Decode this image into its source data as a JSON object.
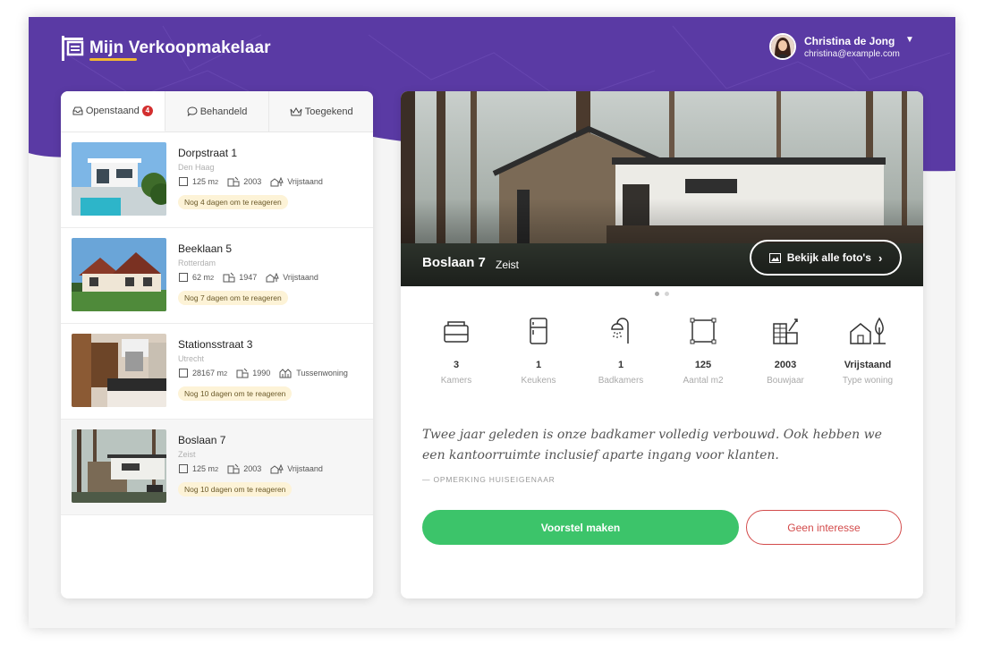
{
  "app": {
    "title": "Mijn Verkoopmakelaar",
    "brand_color": "#5a3aa4",
    "accent_color": "#f2b632"
  },
  "user": {
    "name": "Christina de Jong",
    "email": "christina@example.com",
    "avatar_icon": "avatar-photo",
    "caret_icon": "caret-down-icon"
  },
  "tabs": [
    {
      "label": "Openstaand",
      "icon": "inbox-icon",
      "badge": "4",
      "active": true
    },
    {
      "label": "Behandeld",
      "icon": "chat-icon",
      "active": false
    },
    {
      "label": "Toegekend",
      "icon": "crown-icon",
      "active": false
    }
  ],
  "listings": [
    {
      "title": "Dorpstraat 1",
      "city": "Den Haag",
      "area": "125 m",
      "area_sup": "2",
      "year": "2003",
      "type": "Vrijstaand",
      "deadline": "Nog 4 dagen om te reageren"
    },
    {
      "title": "Beeklaan 5",
      "city": "Rotterdam",
      "area": "62 m",
      "area_sup": "2",
      "year": "1947",
      "type": "Vrijstaand",
      "deadline": "Nog 7 dagen om te reageren"
    },
    {
      "title": "Stationsstraat 3",
      "city": "Utrecht",
      "area": "28167 m",
      "area_sup": "2",
      "year": "1990",
      "type": "Tussenwoning",
      "deadline": "Nog 10 dagen om te reageren"
    },
    {
      "title": "Boslaan 7",
      "city": "Zeist",
      "area": "125 m",
      "area_sup": "2",
      "year": "2003",
      "type": "Vrijstaand",
      "deadline": "Nog 10 dagen om te reageren"
    }
  ],
  "detail": {
    "title": "Boslaan 7",
    "city": "Zeist",
    "photos_button": "Bekijk alle foto's",
    "features": [
      {
        "value": "3",
        "label": "Kamers",
        "icon": "bed-icon"
      },
      {
        "value": "1",
        "label": "Keukens",
        "icon": "fridge-icon"
      },
      {
        "value": "1",
        "label": "Badkamers",
        "icon": "shower-icon"
      },
      {
        "value": "125",
        "label": "Aantal m2",
        "icon": "area-icon"
      },
      {
        "value": "2003",
        "label": "Bouwjaar",
        "icon": "building-year-icon"
      },
      {
        "value": "Vrijstaand",
        "label": "Type woning",
        "icon": "house-tree-icon"
      }
    ],
    "quote": "Twee jaar geleden is onze badkamer volledig verbouwd. Ook hebben we een kantoorruimte inclusief aparte ingang voor klanten.",
    "quote_source": "— OPMERKING HUISEIGENAAR",
    "primary_button": "Voorstel maken",
    "secondary_button": "Geen interesse",
    "primary_color": "#3cc46a",
    "secondary_color": "#d34b4b"
  }
}
